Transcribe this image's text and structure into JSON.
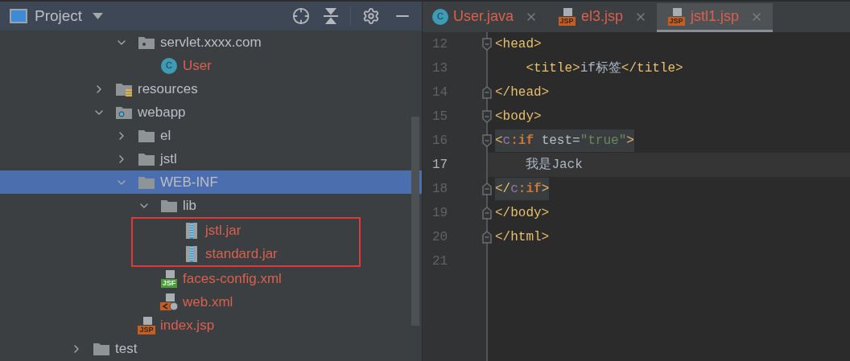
{
  "project_panel": {
    "title": "Project",
    "tree": [
      {
        "kind": "partial",
        "children": [
          {
            "kind": "partial",
            "children": [
              {
                "label": "servlet.xxxx.com",
                "kind": "package",
                "expanded": true,
                "selected": false,
                "unversioned": false,
                "children": [
                  {
                    "label": "User",
                    "kind": "class",
                    "icon_text": "C",
                    "selected": false,
                    "unversioned": true
                  }
                ]
              }
            ]
          },
          {
            "label": "resources",
            "kind": "resources",
            "expanded": false,
            "selected": false,
            "unversioned": false
          },
          {
            "label": "webapp",
            "kind": "webroot",
            "expanded": true,
            "selected": false,
            "unversioned": false,
            "children": [
              {
                "label": "el",
                "kind": "folder",
                "expanded": false,
                "selected": false,
                "unversioned": false
              },
              {
                "label": "jstl",
                "kind": "folder",
                "expanded": false,
                "selected": false,
                "unversioned": false
              },
              {
                "label": "WEB-INF",
                "kind": "folder",
                "expanded": true,
                "selected": true,
                "unversioned": false,
                "children": [
                  {
                    "label": "lib",
                    "kind": "folder",
                    "expanded": true,
                    "selected": false,
                    "unversioned": false,
                    "children_framed": true,
                    "children": [
                      {
                        "label": "jstl.jar",
                        "kind": "jar",
                        "selected": false,
                        "unversioned": true
                      },
                      {
                        "label": "standard.jar",
                        "kind": "jar",
                        "selected": false,
                        "unversioned": true
                      }
                    ]
                  },
                  {
                    "label": "faces-config.xml",
                    "kind": "jsf",
                    "icon_text": "JSF",
                    "selected": false,
                    "unversioned": true
                  },
                  {
                    "label": "web.xml",
                    "kind": "xml",
                    "selected": false,
                    "unversioned": true
                  }
                ]
              },
              {
                "label": "index.jsp",
                "kind": "jsp",
                "icon_text": "JSP",
                "selected": false,
                "unversioned": true
              }
            ]
          }
        ]
      },
      {
        "label": "test",
        "kind": "folder",
        "expanded": false,
        "selected": false,
        "unversioned": false
      }
    ]
  },
  "editor_tabs": [
    {
      "label": "User.java",
      "kind": "class",
      "icon_text": "C",
      "selected": false
    },
    {
      "label": "el3.jsp",
      "kind": "jsp",
      "icon_text": "JSP",
      "selected": false
    },
    {
      "label": "jstl1.jsp",
      "kind": "jsp",
      "icon_text": "JSP",
      "selected": true
    }
  ],
  "code_lines": [
    {
      "number": "12",
      "fold_open": true,
      "fold_close": false,
      "current": false,
      "tag_highlight": false,
      "tokens": [
        {
          "kind": "tag",
          "text": "<head>"
        }
      ]
    },
    {
      "number": "13",
      "fold_open": false,
      "fold_close": false,
      "current": false,
      "tag_highlight": false,
      "tokens": [
        {
          "kind": "tag",
          "text": "    <title>"
        },
        {
          "kind": "text",
          "text": "if标签"
        },
        {
          "kind": "tag",
          "text": "</title>"
        }
      ]
    },
    {
      "number": "14",
      "fold_open": false,
      "fold_close": true,
      "current": false,
      "tag_highlight": false,
      "tokens": [
        {
          "kind": "tag",
          "text": "</head>"
        }
      ]
    },
    {
      "number": "15",
      "fold_open": true,
      "fold_close": false,
      "current": false,
      "tag_highlight": false,
      "tokens": [
        {
          "kind": "tag",
          "text": "<body>"
        }
      ]
    },
    {
      "number": "16",
      "fold_open": true,
      "fold_close": false,
      "current": false,
      "tag_highlight": true,
      "tokens": [
        {
          "kind": "tag",
          "text": "<"
        },
        {
          "kind": "ns",
          "text": "c"
        },
        {
          "kind": "keyword",
          "text": ":if"
        },
        {
          "kind": "attr",
          "text": " test="
        },
        {
          "kind": "string",
          "text": "\"true\""
        },
        {
          "kind": "plain",
          "text": ">"
        }
      ]
    },
    {
      "number": "17",
      "fold_open": false,
      "fold_close": false,
      "current": true,
      "tag_highlight": false,
      "tokens": [
        {
          "kind": "text",
          "text": "    我是Jack"
        }
      ]
    },
    {
      "number": "18",
      "fold_open": false,
      "fold_close": true,
      "current": false,
      "tag_highlight": true,
      "tokens": [
        {
          "kind": "tag",
          "text": "</"
        },
        {
          "kind": "ns",
          "text": "c"
        },
        {
          "kind": "keyword",
          "text": ":if"
        },
        {
          "kind": "plain",
          "text": ">"
        }
      ]
    },
    {
      "number": "19",
      "fold_open": false,
      "fold_close": true,
      "current": false,
      "tag_highlight": false,
      "tokens": [
        {
          "kind": "tag",
          "text": "</body>"
        }
      ]
    },
    {
      "number": "20",
      "fold_open": false,
      "fold_close": true,
      "current": false,
      "tag_highlight": false,
      "tokens": [
        {
          "kind": "tag",
          "text": "</html>"
        }
      ]
    },
    {
      "number": "21",
      "fold_open": false,
      "fold_close": false,
      "current": false
    }
  ]
}
